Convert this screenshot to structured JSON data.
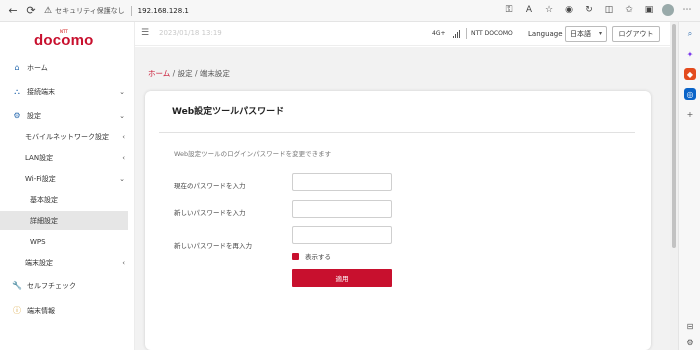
{
  "browser": {
    "security_text": "セキュリティ保護なし",
    "url": "192.168.128.1"
  },
  "sidebar": {
    "logo_small": "NTT",
    "logo": "docomo",
    "items": [
      {
        "label": "ホーム"
      },
      {
        "label": "接続端末"
      },
      {
        "label": "設定"
      },
      {
        "label": "モバイルネットワーク設定"
      },
      {
        "label": "LAN設定"
      },
      {
        "label": "Wi-Fi設定"
      },
      {
        "label": "基本設定"
      },
      {
        "label": "詳細設定"
      },
      {
        "label": "WPS"
      },
      {
        "label": "端末設定"
      },
      {
        "label": "セルフチェック"
      },
      {
        "label": "端末情報"
      }
    ]
  },
  "header": {
    "datetime": "2023/01/18 13:19",
    "network": "4G+",
    "carrier": "NTT DOCOMO",
    "language_label": "Language",
    "language_value": "日本語",
    "logout_label": "ログアウト"
  },
  "breadcrumb": {
    "home": "ホーム",
    "sep1": " / ",
    "level2": "設定",
    "sep2": " / ",
    "level3": "端末設定"
  },
  "card": {
    "title": "Web設定ツールパスワード",
    "description": "Web設定ツールのログインパスワードを変更できます",
    "current_password_label": "現在のパスワードを入力",
    "new_password_label": "新しいパスワードを入力",
    "confirm_password_label": "新しいパスワードを再入力",
    "show_label": "表示する",
    "apply_label": "適用"
  },
  "colors": {
    "brand": "#c8102e",
    "content_bg": "#f2f2f2"
  }
}
